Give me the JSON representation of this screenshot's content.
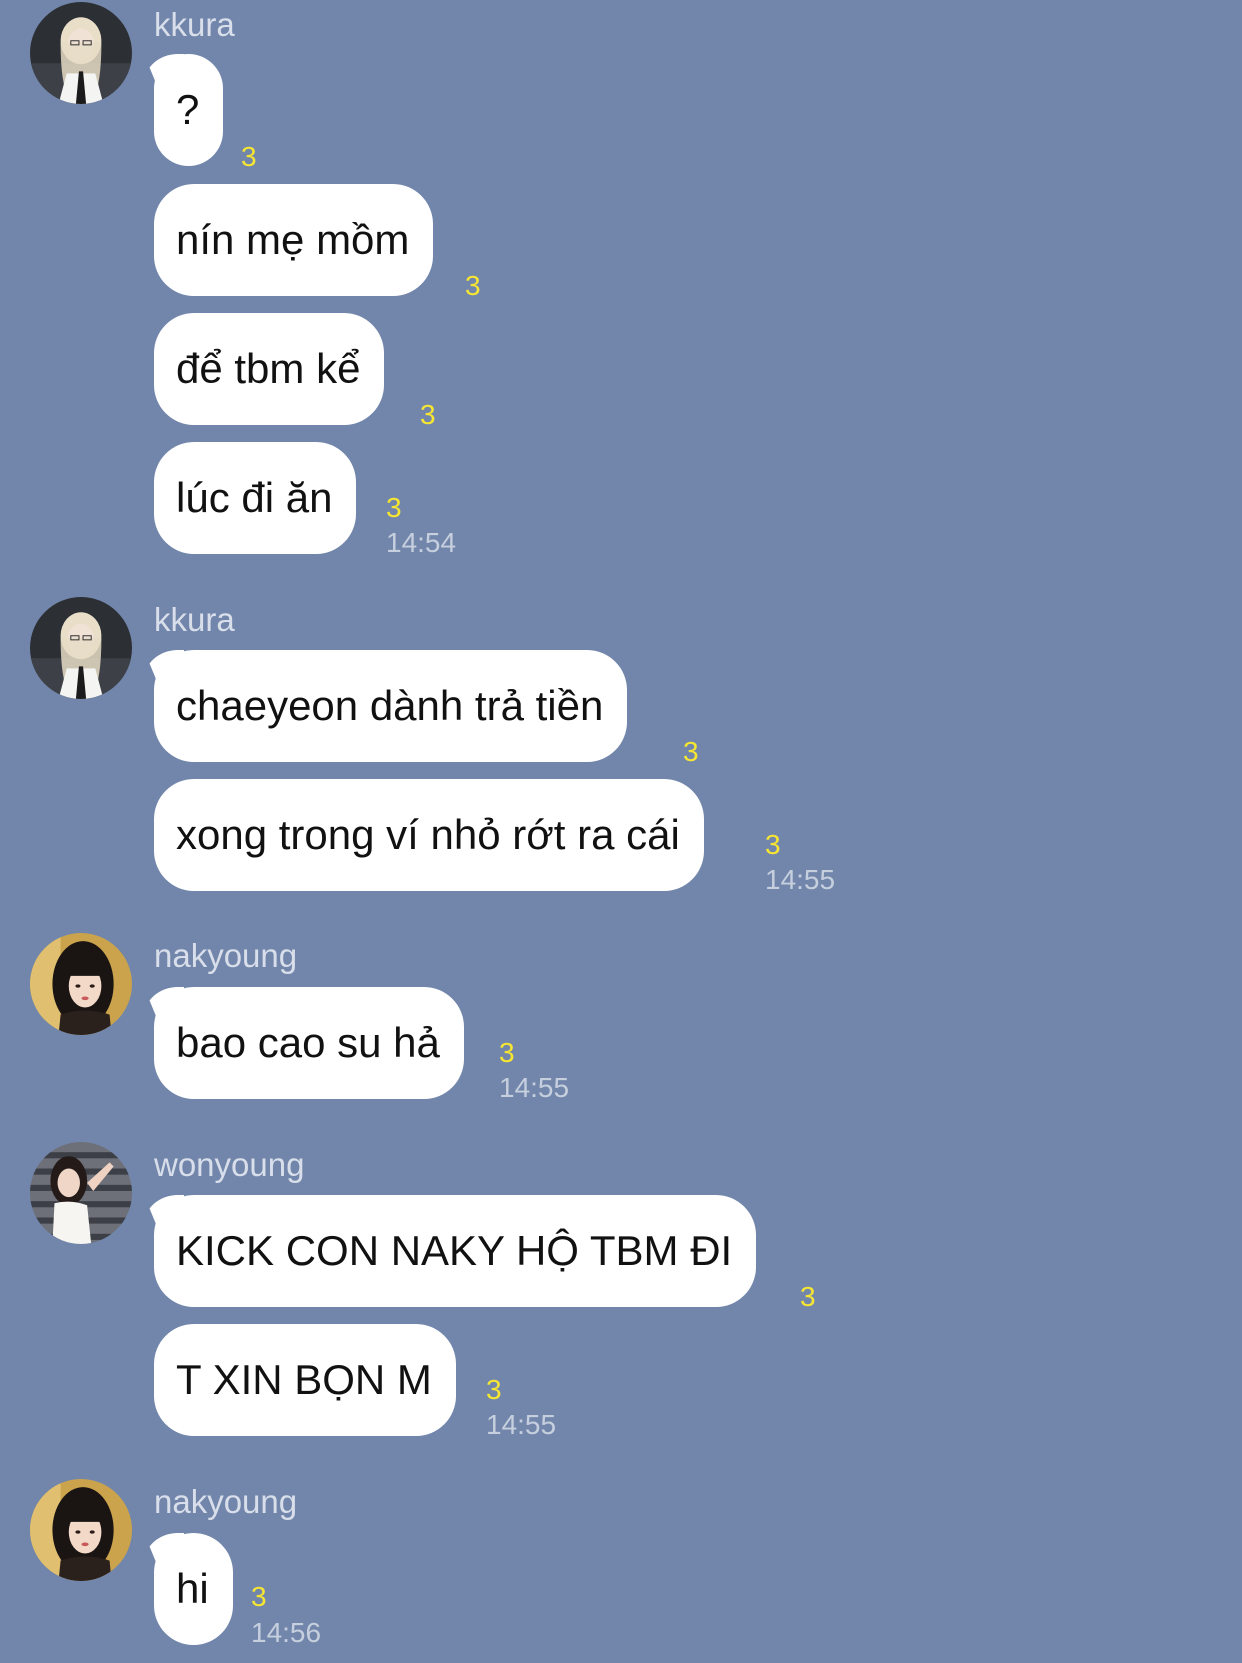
{
  "colors": {
    "background": "#7286ab",
    "bubble": "#ffffff",
    "read_count": "#f6e632",
    "timestamp": "#c6cfde",
    "sender_name": "#d8deea"
  },
  "groups": [
    {
      "sender": "kkura",
      "avatar_icon": "avatar-kkura-photo",
      "messages": [
        {
          "text": "?",
          "read": "3"
        },
        {
          "text": "nín mẹ mồm",
          "read": "3"
        },
        {
          "text": "để tbm kể",
          "read": "3"
        },
        {
          "text": "lúc đi ăn",
          "read": "3",
          "time": "14:54"
        }
      ]
    },
    {
      "sender": "kkura",
      "avatar_icon": "avatar-kkura-photo",
      "messages": [
        {
          "text": "chaeyeon dành trả tiền",
          "read": "3"
        },
        {
          "text": "xong trong ví nhỏ rớt ra cái",
          "read": "3",
          "time": "14:55"
        }
      ]
    },
    {
      "sender": "nakyoung",
      "avatar_icon": "avatar-nakyoung-photo",
      "messages": [
        {
          "text": "bao cao su hả",
          "read": "3",
          "time": "14:55"
        }
      ]
    },
    {
      "sender": "wonyoung",
      "avatar_icon": "avatar-wonyoung-photo",
      "messages": [
        {
          "text": "KICK CON NAKY HỘ TBM ĐI",
          "read": "3"
        },
        {
          "text": "T XIN BỌN M",
          "read": "3",
          "time": "14:55"
        }
      ]
    },
    {
      "sender": "nakyoung",
      "avatar_icon": "avatar-nakyoung-photo",
      "messages": [
        {
          "text": "hi",
          "read": "3",
          "time": "14:56"
        }
      ]
    }
  ]
}
